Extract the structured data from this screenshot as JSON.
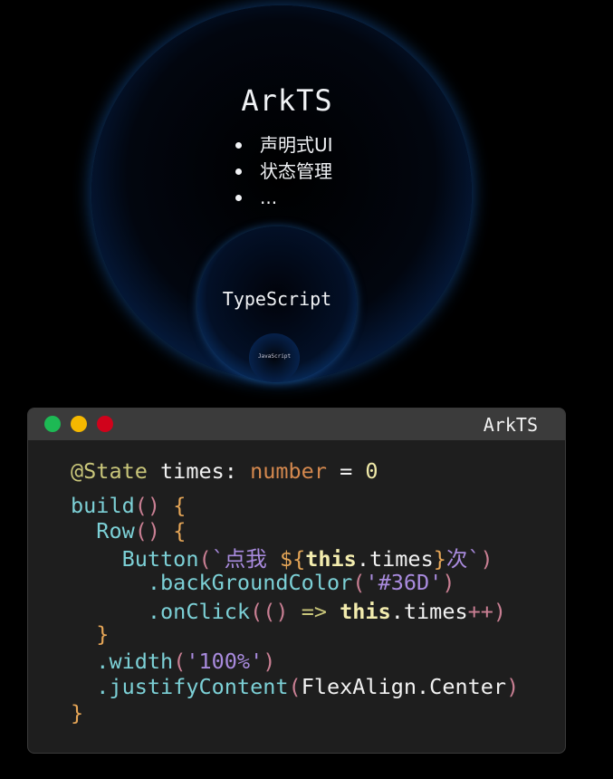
{
  "diagram": {
    "outer_title": "ArkTS",
    "bullets": [
      "声明式UI",
      "状态管理",
      "..."
    ],
    "middle_title": "TypeScript",
    "inner_title": "JavaScript"
  },
  "window": {
    "title": "ArkTS",
    "traffic_lights": [
      "#1db954",
      "#f5b800",
      "#d0021b"
    ],
    "code_lines": [
      [
        [
          "dec",
          "@State"
        ],
        [
          "w",
          " times: "
        ],
        [
          "ty",
          "number"
        ],
        [
          "w",
          " = "
        ],
        [
          "num",
          "0"
        ]
      ],
      [
        [
          "kw",
          "build"
        ],
        [
          "p",
          "()"
        ],
        [
          "w",
          " "
        ],
        [
          "br",
          "{"
        ]
      ],
      [
        [
          "w",
          "  "
        ],
        [
          "kw",
          "Row"
        ],
        [
          "p",
          "()"
        ],
        [
          "w",
          " "
        ],
        [
          "br",
          "{"
        ]
      ],
      [
        [
          "w",
          "    "
        ],
        [
          "kw",
          "Button"
        ],
        [
          "p",
          "("
        ],
        [
          "str",
          "`点我 "
        ],
        [
          "br",
          "${"
        ],
        [
          "th",
          "this"
        ],
        [
          "w",
          ".times"
        ],
        [
          "br",
          "}"
        ],
        [
          "str",
          "次`"
        ],
        [
          "p",
          ")"
        ]
      ],
      [
        [
          "w",
          "      "
        ],
        [
          "kw",
          ".backGroundColor"
        ],
        [
          "p",
          "("
        ],
        [
          "str",
          "'#36D'"
        ],
        [
          "p",
          ")"
        ]
      ],
      [
        [
          "w",
          "      "
        ],
        [
          "kw",
          ".onClick"
        ],
        [
          "p",
          "(()"
        ],
        [
          "w",
          " "
        ],
        [
          "dec",
          "=>"
        ],
        [
          "w",
          " "
        ],
        [
          "th",
          "this"
        ],
        [
          "w",
          ".times"
        ],
        [
          "p",
          "++)"
        ]
      ],
      [
        [
          "w",
          "  "
        ],
        [
          "br",
          "}"
        ]
      ],
      [
        [
          "w",
          "  "
        ],
        [
          "kw",
          ".width"
        ],
        [
          "p",
          "("
        ],
        [
          "str",
          "'100%'"
        ],
        [
          "p",
          ")"
        ]
      ],
      [
        [
          "w",
          "  "
        ],
        [
          "kw",
          ".justifyContent"
        ],
        [
          "p",
          "("
        ],
        [
          "w",
          "FlexAlign.Center"
        ],
        [
          "p",
          ")"
        ]
      ],
      [
        [
          "br",
          "}"
        ]
      ]
    ]
  }
}
